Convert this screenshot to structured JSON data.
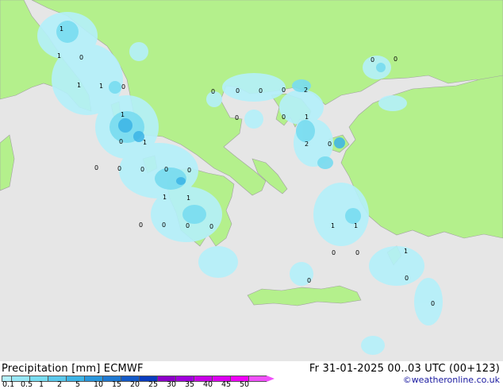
{
  "map": {
    "point_labels": [
      "1",
      "1",
      "0",
      "1",
      "1",
      "0",
      "1",
      "0",
      "1",
      "0",
      "0",
      "0",
      "0",
      "0",
      "1",
      "1",
      "0",
      "0",
      "0",
      "0",
      "0",
      "0",
      "0",
      "0",
      "0",
      "2",
      "0",
      "1",
      "2",
      "0",
      "0",
      "1",
      "1",
      "0",
      "0",
      "0",
      "1",
      "0",
      "0",
      "0"
    ]
  },
  "footer": {
    "title": "Precipitation [mm]  ECMWF",
    "valid_time": "Fr 31-01-2025 00..03 UTC (00+123)",
    "credit": "©weatheronline.co.uk"
  },
  "legend": {
    "labels": [
      "0.1",
      "0.5",
      "1",
      "2",
      "5",
      "10",
      "15",
      "20",
      "25",
      "30",
      "35",
      "40",
      "45",
      "50"
    ],
    "colors": [
      "#b4f0fa",
      "#96e6f5",
      "#78dcf0",
      "#5ac8eb",
      "#3cb4e6",
      "#2896dc",
      "#1e78d2",
      "#145ac8",
      "#0a3cbe",
      "#8c00c8",
      "#a000dc",
      "#c800e6",
      "#dc00f0",
      "#f000f8",
      "#f050fa"
    ]
  }
}
